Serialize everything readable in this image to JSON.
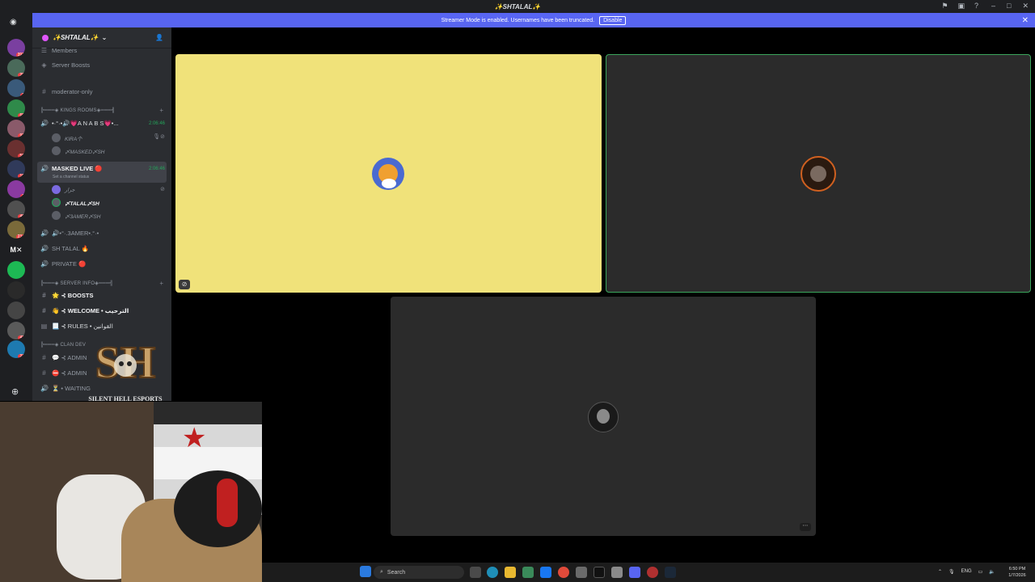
{
  "window": {
    "title": "✨SHTALAL✨",
    "controls": [
      "–",
      "□",
      "✕"
    ]
  },
  "streamer_banner": {
    "text": "Streamer Mode is enabled. Usernames have been truncated.",
    "disable_label": "Disable",
    "close": "✕"
  },
  "guild_badges": [
    "391",
    "29",
    "1",
    "60",
    "92",
    "56",
    "10",
    "1",
    "46",
    "234",
    "",
    "",
    "",
    "",
    "42",
    "27"
  ],
  "server": {
    "name": "✨SHTALAL✨",
    "items": [
      {
        "label": "Members",
        "icon": "members-icon"
      },
      {
        "label": "Server Boosts",
        "icon": "boost-icon"
      },
      {
        "label": "moderator-only",
        "icon": "hash-icon"
      }
    ],
    "categories": {
      "kings": "╠═══◈ KINGS ROOMS◈═══╣",
      "info": "╠═══◈ SERVER INFO◈═══╣",
      "clan": "╠═══◈ CLAN DEV"
    },
    "voice": [
      {
        "label": "•·°·•🔊💗A N A B S💗•...",
        "timer": "2:06:46"
      },
      {
        "label": "MASKED LIVE 🔴",
        "status": "Set a channel status",
        "timer": "2:06:46"
      },
      {
        "label": "🔊•°·.3AMER•.°·•"
      },
      {
        "label": "SH TALAL 🔥"
      },
      {
        "label": "PRIVATE 🔴"
      }
    ],
    "users": {
      "kira": "KIRA个",
      "masked": "〆MASKED〆SH",
      "arabic": "جرار",
      "talal": "〆TALAL〆SH",
      "samer": "〆3AMER〆SH"
    },
    "text_channels": [
      {
        "label": "🌟 ⊰ BOOSTS"
      },
      {
        "label": "👋 ⊰ WELCOME • الترحيب"
      },
      {
        "label": "📃 ⊰ RULES • القوانين"
      },
      {
        "label": "💬 ⊰ ADMIN"
      },
      {
        "label": "⛔ ⊰ ADMIN"
      },
      {
        "label": "⏳ • WAITING"
      }
    ]
  },
  "logo": {
    "letters": "SH",
    "caption": "SILENT HELL ESPORTS"
  },
  "taskbar": {
    "search_placeholder": "Search",
    "lang": "ENG",
    "time": "6:50 PM",
    "date": "1/7/2026"
  },
  "colors": {
    "accent": "#5865f2",
    "speaking": "#3ba55c",
    "tile_yellow": "#f0e27a",
    "tile_dark": "#2b2b2b"
  }
}
